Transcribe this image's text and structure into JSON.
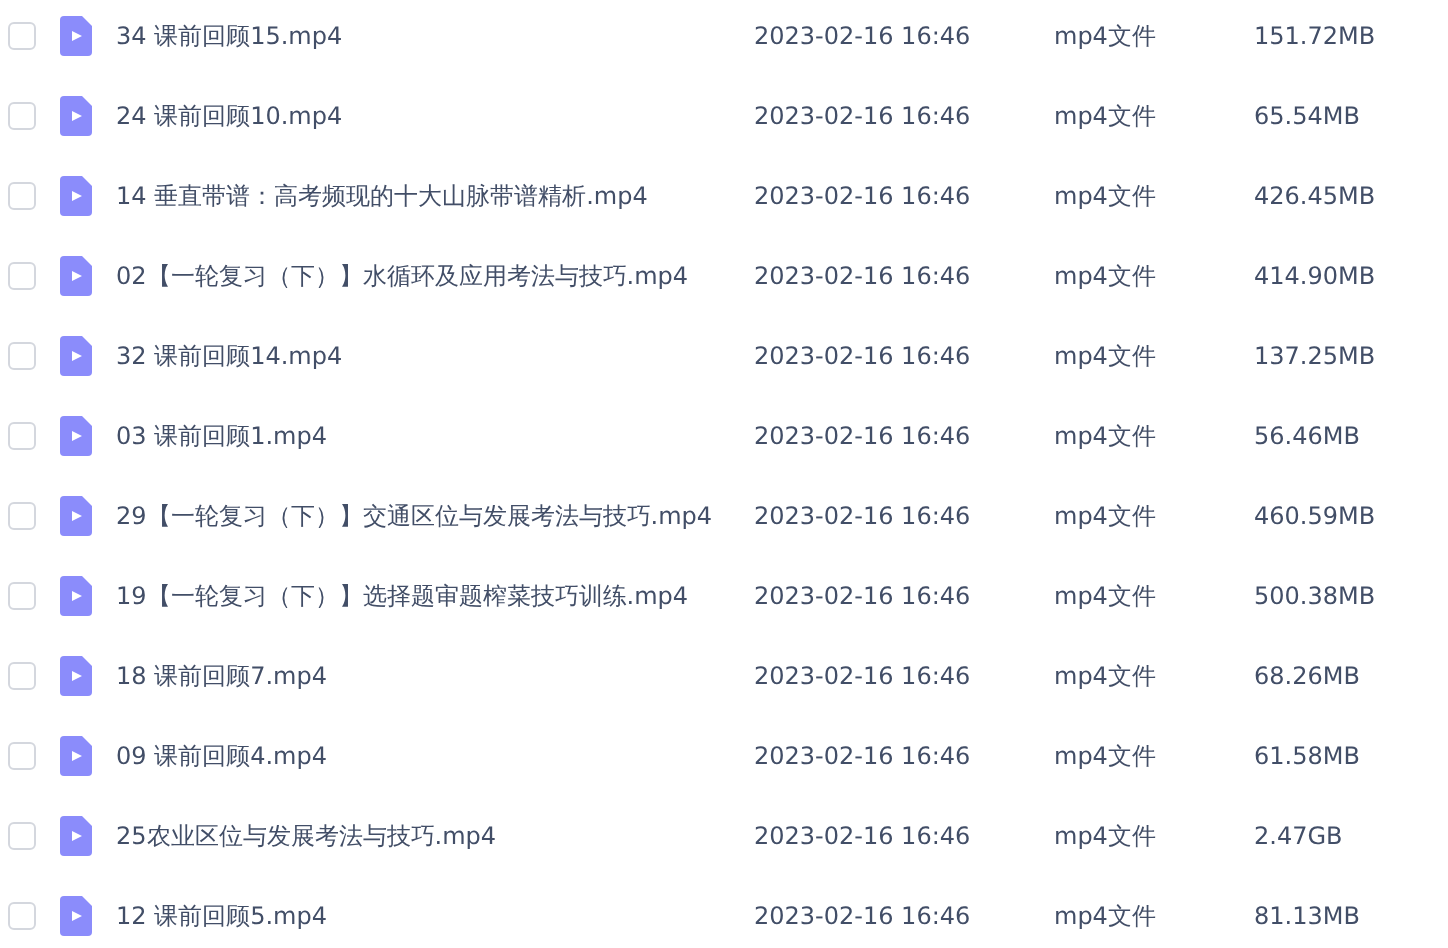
{
  "files": [
    {
      "name": "34 课前回顾15.mp4",
      "modified": "2023-02-16 16:46",
      "type": "mp4文件",
      "size": "151.72MB",
      "checked": false
    },
    {
      "name": "24 课前回顾10.mp4",
      "modified": "2023-02-16 16:46",
      "type": "mp4文件",
      "size": "65.54MB",
      "checked": false
    },
    {
      "name": "14 垂直带谱：高考频现的十大山脉带谱精析.mp4",
      "modified": "2023-02-16 16:46",
      "type": "mp4文件",
      "size": "426.45MB",
      "checked": false
    },
    {
      "name": "02【一轮复习（下）】水循环及应用考法与技巧.mp4",
      "modified": "2023-02-16 16:46",
      "type": "mp4文件",
      "size": "414.90MB",
      "checked": false
    },
    {
      "name": "32 课前回顾14.mp4",
      "modified": "2023-02-16 16:46",
      "type": "mp4文件",
      "size": "137.25MB",
      "checked": false
    },
    {
      "name": "03 课前回顾1.mp4",
      "modified": "2023-02-16 16:46",
      "type": "mp4文件",
      "size": "56.46MB",
      "checked": false
    },
    {
      "name": "29【一轮复习（下）】交通区位与发展考法与技巧.mp4",
      "modified": "2023-02-16 16:46",
      "type": "mp4文件",
      "size": "460.59MB",
      "checked": false
    },
    {
      "name": "19【一轮复习（下）】选择题审题榨菜技巧训练.mp4",
      "modified": "2023-02-16 16:46",
      "type": "mp4文件",
      "size": "500.38MB",
      "checked": false
    },
    {
      "name": "18 课前回顾7.mp4",
      "modified": "2023-02-16 16:46",
      "type": "mp4文件",
      "size": "68.26MB",
      "checked": false
    },
    {
      "name": "09 课前回顾4.mp4",
      "modified": "2023-02-16 16:46",
      "type": "mp4文件",
      "size": "61.58MB",
      "checked": false
    },
    {
      "name": "25农业区位与发展考法与技巧.mp4",
      "modified": "2023-02-16 16:46",
      "type": "mp4文件",
      "size": "2.47GB",
      "checked": false
    },
    {
      "name": "12 课前回顾5.mp4",
      "modified": "2023-02-16 16:46",
      "type": "mp4文件",
      "size": "81.13MB",
      "checked": false
    }
  ]
}
